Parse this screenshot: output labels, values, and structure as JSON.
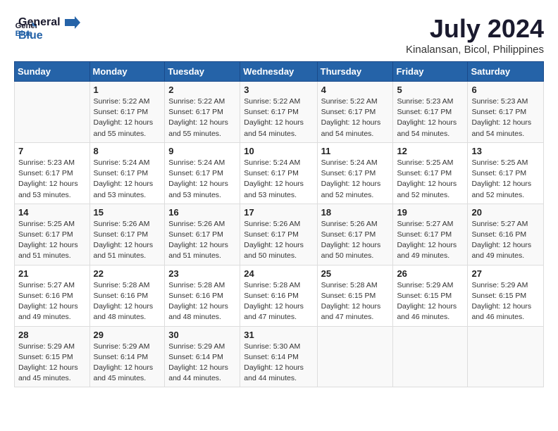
{
  "logo": {
    "line1": "General",
    "line2": "Blue"
  },
  "title": "July 2024",
  "location": "Kinalansan, Bicol, Philippines",
  "header_days": [
    "Sunday",
    "Monday",
    "Tuesday",
    "Wednesday",
    "Thursday",
    "Friday",
    "Saturday"
  ],
  "weeks": [
    [
      {
        "day": "",
        "sunrise": "",
        "sunset": "",
        "daylight": ""
      },
      {
        "day": "1",
        "sunrise": "Sunrise: 5:22 AM",
        "sunset": "Sunset: 6:17 PM",
        "daylight": "Daylight: 12 hours and 55 minutes."
      },
      {
        "day": "2",
        "sunrise": "Sunrise: 5:22 AM",
        "sunset": "Sunset: 6:17 PM",
        "daylight": "Daylight: 12 hours and 55 minutes."
      },
      {
        "day": "3",
        "sunrise": "Sunrise: 5:22 AM",
        "sunset": "Sunset: 6:17 PM",
        "daylight": "Daylight: 12 hours and 54 minutes."
      },
      {
        "day": "4",
        "sunrise": "Sunrise: 5:22 AM",
        "sunset": "Sunset: 6:17 PM",
        "daylight": "Daylight: 12 hours and 54 minutes."
      },
      {
        "day": "5",
        "sunrise": "Sunrise: 5:23 AM",
        "sunset": "Sunset: 6:17 PM",
        "daylight": "Daylight: 12 hours and 54 minutes."
      },
      {
        "day": "6",
        "sunrise": "Sunrise: 5:23 AM",
        "sunset": "Sunset: 6:17 PM",
        "daylight": "Daylight: 12 hours and 54 minutes."
      }
    ],
    [
      {
        "day": "7",
        "sunrise": "Sunrise: 5:23 AM",
        "sunset": "Sunset: 6:17 PM",
        "daylight": "Daylight: 12 hours and 53 minutes."
      },
      {
        "day": "8",
        "sunrise": "Sunrise: 5:24 AM",
        "sunset": "Sunset: 6:17 PM",
        "daylight": "Daylight: 12 hours and 53 minutes."
      },
      {
        "day": "9",
        "sunrise": "Sunrise: 5:24 AM",
        "sunset": "Sunset: 6:17 PM",
        "daylight": "Daylight: 12 hours and 53 minutes."
      },
      {
        "day": "10",
        "sunrise": "Sunrise: 5:24 AM",
        "sunset": "Sunset: 6:17 PM",
        "daylight": "Daylight: 12 hours and 53 minutes."
      },
      {
        "day": "11",
        "sunrise": "Sunrise: 5:24 AM",
        "sunset": "Sunset: 6:17 PM",
        "daylight": "Daylight: 12 hours and 52 minutes."
      },
      {
        "day": "12",
        "sunrise": "Sunrise: 5:25 AM",
        "sunset": "Sunset: 6:17 PM",
        "daylight": "Daylight: 12 hours and 52 minutes."
      },
      {
        "day": "13",
        "sunrise": "Sunrise: 5:25 AM",
        "sunset": "Sunset: 6:17 PM",
        "daylight": "Daylight: 12 hours and 52 minutes."
      }
    ],
    [
      {
        "day": "14",
        "sunrise": "Sunrise: 5:25 AM",
        "sunset": "Sunset: 6:17 PM",
        "daylight": "Daylight: 12 hours and 51 minutes."
      },
      {
        "day": "15",
        "sunrise": "Sunrise: 5:26 AM",
        "sunset": "Sunset: 6:17 PM",
        "daylight": "Daylight: 12 hours and 51 minutes."
      },
      {
        "day": "16",
        "sunrise": "Sunrise: 5:26 AM",
        "sunset": "Sunset: 6:17 PM",
        "daylight": "Daylight: 12 hours and 51 minutes."
      },
      {
        "day": "17",
        "sunrise": "Sunrise: 5:26 AM",
        "sunset": "Sunset: 6:17 PM",
        "daylight": "Daylight: 12 hours and 50 minutes."
      },
      {
        "day": "18",
        "sunrise": "Sunrise: 5:26 AM",
        "sunset": "Sunset: 6:17 PM",
        "daylight": "Daylight: 12 hours and 50 minutes."
      },
      {
        "day": "19",
        "sunrise": "Sunrise: 5:27 AM",
        "sunset": "Sunset: 6:17 PM",
        "daylight": "Daylight: 12 hours and 49 minutes."
      },
      {
        "day": "20",
        "sunrise": "Sunrise: 5:27 AM",
        "sunset": "Sunset: 6:16 PM",
        "daylight": "Daylight: 12 hours and 49 minutes."
      }
    ],
    [
      {
        "day": "21",
        "sunrise": "Sunrise: 5:27 AM",
        "sunset": "Sunset: 6:16 PM",
        "daylight": "Daylight: 12 hours and 49 minutes."
      },
      {
        "day": "22",
        "sunrise": "Sunrise: 5:28 AM",
        "sunset": "Sunset: 6:16 PM",
        "daylight": "Daylight: 12 hours and 48 minutes."
      },
      {
        "day": "23",
        "sunrise": "Sunrise: 5:28 AM",
        "sunset": "Sunset: 6:16 PM",
        "daylight": "Daylight: 12 hours and 48 minutes."
      },
      {
        "day": "24",
        "sunrise": "Sunrise: 5:28 AM",
        "sunset": "Sunset: 6:16 PM",
        "daylight": "Daylight: 12 hours and 47 minutes."
      },
      {
        "day": "25",
        "sunrise": "Sunrise: 5:28 AM",
        "sunset": "Sunset: 6:15 PM",
        "daylight": "Daylight: 12 hours and 47 minutes."
      },
      {
        "day": "26",
        "sunrise": "Sunrise: 5:29 AM",
        "sunset": "Sunset: 6:15 PM",
        "daylight": "Daylight: 12 hours and 46 minutes."
      },
      {
        "day": "27",
        "sunrise": "Sunrise: 5:29 AM",
        "sunset": "Sunset: 6:15 PM",
        "daylight": "Daylight: 12 hours and 46 minutes."
      }
    ],
    [
      {
        "day": "28",
        "sunrise": "Sunrise: 5:29 AM",
        "sunset": "Sunset: 6:15 PM",
        "daylight": "Daylight: 12 hours and 45 minutes."
      },
      {
        "day": "29",
        "sunrise": "Sunrise: 5:29 AM",
        "sunset": "Sunset: 6:14 PM",
        "daylight": "Daylight: 12 hours and 45 minutes."
      },
      {
        "day": "30",
        "sunrise": "Sunrise: 5:29 AM",
        "sunset": "Sunset: 6:14 PM",
        "daylight": "Daylight: 12 hours and 44 minutes."
      },
      {
        "day": "31",
        "sunrise": "Sunrise: 5:30 AM",
        "sunset": "Sunset: 6:14 PM",
        "daylight": "Daylight: 12 hours and 44 minutes."
      },
      {
        "day": "",
        "sunrise": "",
        "sunset": "",
        "daylight": ""
      },
      {
        "day": "",
        "sunrise": "",
        "sunset": "",
        "daylight": ""
      },
      {
        "day": "",
        "sunrise": "",
        "sunset": "",
        "daylight": ""
      }
    ]
  ]
}
